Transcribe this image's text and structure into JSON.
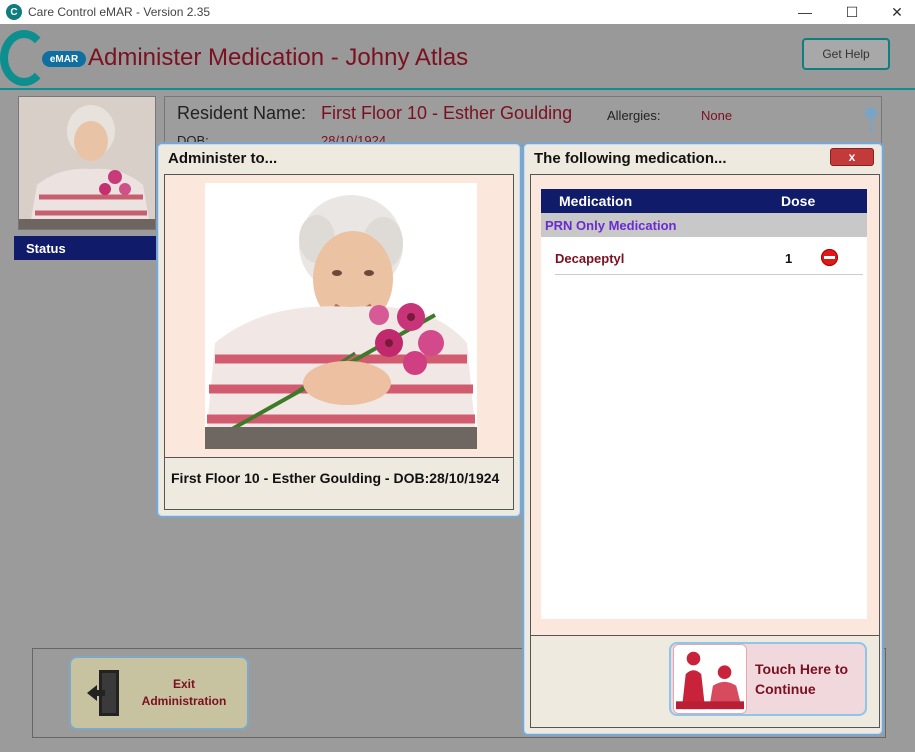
{
  "window": {
    "title": "Care Control eMAR - Version 2.35",
    "app_icon": "care-control-logo-icon",
    "controls": {
      "minimize": "—",
      "maximize": "☐",
      "close": "✕"
    }
  },
  "header": {
    "logo_badge": "eMAR",
    "title": "Administer Medication - Johny Atlas",
    "help_label": "Get Help"
  },
  "resident": {
    "name_label": "Resident Name:",
    "name_value": "First Floor 10 - Esther Goulding",
    "allergies_label": "Allergies:",
    "allergies_value": "None",
    "dob_label": "DOB:",
    "dob_value": "28/10/1924"
  },
  "sidebar": {
    "status_label": "Status"
  },
  "administer_dialog": {
    "title": "Administer to...",
    "caption": "First Floor 10 - Esther Goulding - DOB:28/10/1924"
  },
  "medication_dialog": {
    "title": "The following medication...",
    "close_label": "x",
    "columns": {
      "medication": "Medication",
      "dose": "Dose"
    },
    "group_label": "PRN Only Medication",
    "rows": [
      {
        "name": "Decapeptyl",
        "dose": "1",
        "action_icon": "remove-icon"
      }
    ],
    "continue_label": "Touch Here to\nContinue"
  },
  "footer": {
    "exit_label": "Exit\nAdministration"
  },
  "colors": {
    "accent_teal": "#0e8f8f",
    "title_maroon": "#7a1020",
    "header_navy": "#101c6a",
    "group_purple": "#6a2bd1",
    "dialog_border": "#7aa7cf"
  }
}
